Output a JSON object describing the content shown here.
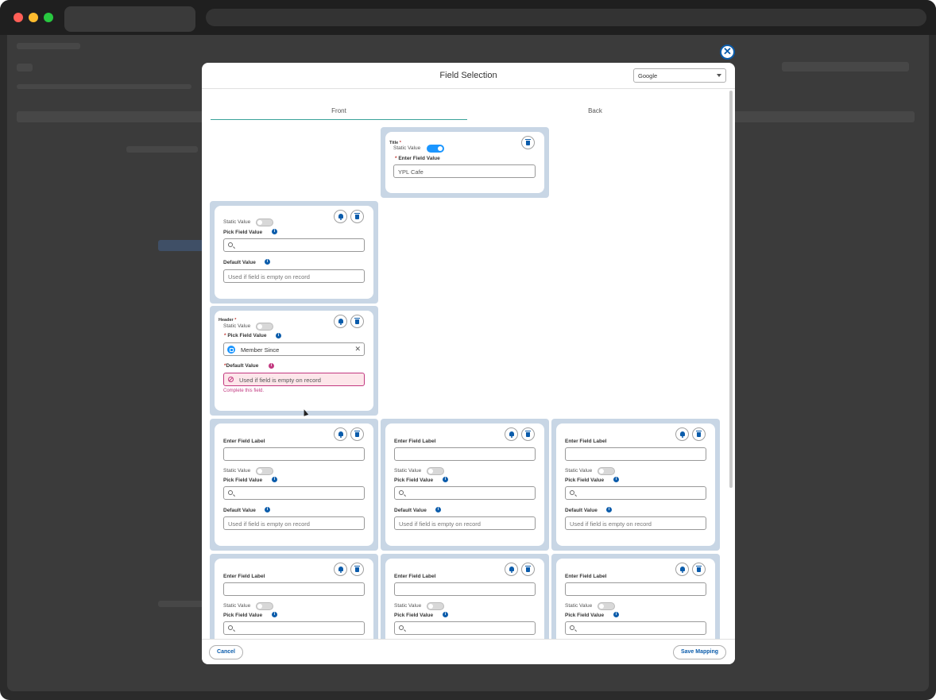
{
  "modal": {
    "title": "Field Selection",
    "close_label": "✕",
    "platform_select": {
      "value": "Google"
    },
    "tabs": [
      {
        "label": "Front"
      },
      {
        "label": "Back"
      }
    ],
    "cancel_label": "Cancel",
    "save_label": "Save Mapping"
  },
  "labels": {
    "static_value": "Static Value",
    "pick_field_value": "Pick Field Value",
    "default_value": "Default Value",
    "enter_field_label": "Enter Field Label",
    "enter_field_value": "Enter Field Value",
    "required_star": "*",
    "default_placeholder": "Used if field is empty on record"
  },
  "title_card": {
    "heading": "Title",
    "value": "YPL Cafe"
  },
  "header_card": {
    "heading": "Header",
    "pick_value": "Member Since",
    "error_text": "Complete this field."
  },
  "colors": {
    "accent": "#0b5cab",
    "toggle_on": "#1b96ff",
    "card_bg": "#c8d6e5",
    "error": "#c23980",
    "tab_underline": "#3ba29a"
  }
}
